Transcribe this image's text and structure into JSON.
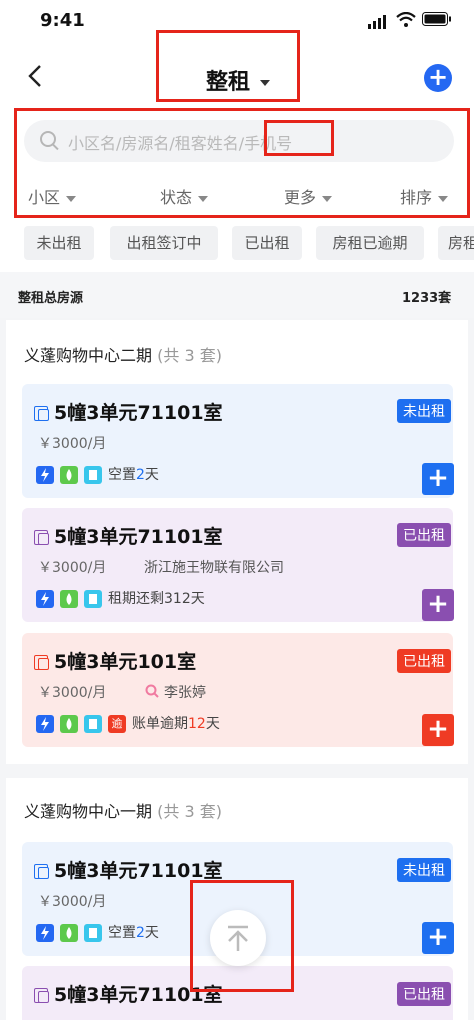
{
  "status": {
    "time": "9:41"
  },
  "header": {
    "title": "整租",
    "add_label": "+"
  },
  "search": {
    "placeholder": "小区名/房源名/租客姓名/手机号"
  },
  "filters": [
    "小区",
    "状态",
    "更多",
    "排序"
  ],
  "chips": [
    "未出租",
    "出租签订中",
    "已出租",
    "房租已逾期",
    "房租"
  ],
  "summary": {
    "label": "整租总房源",
    "value": "1233套"
  },
  "sections": [
    {
      "title": "义蓬购物中心二期",
      "count": "(共 3 套)",
      "cards": [
        {
          "room": "5幢3单元71101室",
          "price": "￥3000/月",
          "tenant": "",
          "status": "未出租",
          "info_pre": "空置",
          "info_num": "2",
          "info_post": "天"
        },
        {
          "room": "5幢3单元71101室",
          "price": "￥3000/月",
          "tenant": "浙江施王物联有限公司",
          "status": "已出租",
          "info_pre": "租期还剩",
          "info_num": "312",
          "info_post": "天"
        },
        {
          "room": "5幢3单元101室",
          "price": "￥3000/月",
          "tenant": "李张婷",
          "status": "已出租",
          "info_pre": "账单逾期",
          "info_num": "12",
          "info_post": "天",
          "overdue_icon": "逾"
        }
      ]
    },
    {
      "title": "义蓬购物中心一期",
      "count": "(共 3 套)",
      "cards": [
        {
          "room": "5幢3单元71101室",
          "price": "￥3000/月",
          "status": "未出租",
          "info_pre": "空置",
          "info_num": "2",
          "info_post": "天"
        },
        {
          "room": "5幢3单元71101室",
          "status": "已出租"
        }
      ]
    }
  ],
  "colors": {
    "accent": "#2468f2",
    "vacant": "#1e6ff0",
    "rented": "#8a4fb0",
    "overdue": "#ef3b24",
    "highlight_box": "#e5241a"
  },
  "icons": [
    "back-arrow-icon",
    "add-circle-icon",
    "search-icon",
    "caret-down-icon",
    "house-doc-icon",
    "bolt-icon",
    "water-drop-icon",
    "doc-icon",
    "magnifier-person-icon",
    "back-to-top-icon"
  ]
}
